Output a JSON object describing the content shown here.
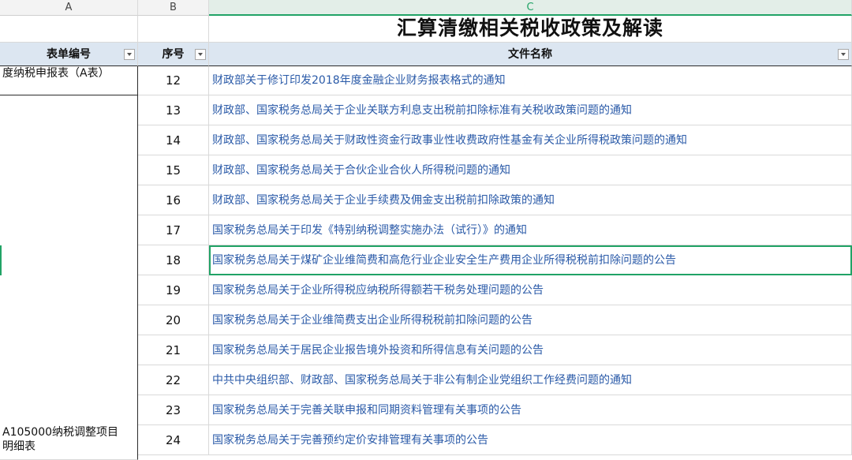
{
  "columns": {
    "a": "A",
    "b": "B",
    "c": "C"
  },
  "title": "汇算清缴相关税收政策及解读",
  "headers": {
    "form": "表单编号",
    "seq": "序号",
    "file": "文件名称"
  },
  "form_partial": "度纳税申报表（A表）",
  "form_main": "A105000纳税调整项目明细表",
  "rows": [
    {
      "seq": "12",
      "name": "财政部关于修订印发2018年度金融企业财务报表格式的通知"
    },
    {
      "seq": "13",
      "name": "财政部、国家税务总局关于企业关联方利息支出税前扣除标准有关税收政策问题的通知"
    },
    {
      "seq": "14",
      "name": "财政部、国家税务总局关于财政性资金行政事业性收费政府性基金有关企业所得税政策问题的通知"
    },
    {
      "seq": "15",
      "name": "财政部、国家税务总局关于合伙企业合伙人所得税问题的通知"
    },
    {
      "seq": "16",
      "name": "财政部、国家税务总局关于企业手续费及佣金支出税前扣除政策的通知"
    },
    {
      "seq": "17",
      "name": "国家税务总局关于印发《特别纳税调整实施办法（试行）》的通知"
    },
    {
      "seq": "18",
      "name": "国家税务总局关于煤矿企业维简费和高危行业企业安全生产费用企业所得税税前扣除问题的公告"
    },
    {
      "seq": "19",
      "name": "国家税务总局关于企业所得税应纳税所得额若干税务处理问题的公告"
    },
    {
      "seq": "20",
      "name": "国家税务总局关于企业维简费支出企业所得税税前扣除问题的公告"
    },
    {
      "seq": "21",
      "name": "国家税务总局关于居民企业报告境外投资和所得信息有关问题的公告"
    },
    {
      "seq": "22",
      "name": "中共中央组织部、财政部、国家税务总局关于非公有制企业党组织工作经费问题的通知"
    },
    {
      "seq": "23",
      "name": "国家税务总局关于完善关联申报和同期资料管理有关事项的公告"
    },
    {
      "seq": "24",
      "name": "国家税务总局关于完善预约定价安排管理有关事项的公告"
    }
  ]
}
